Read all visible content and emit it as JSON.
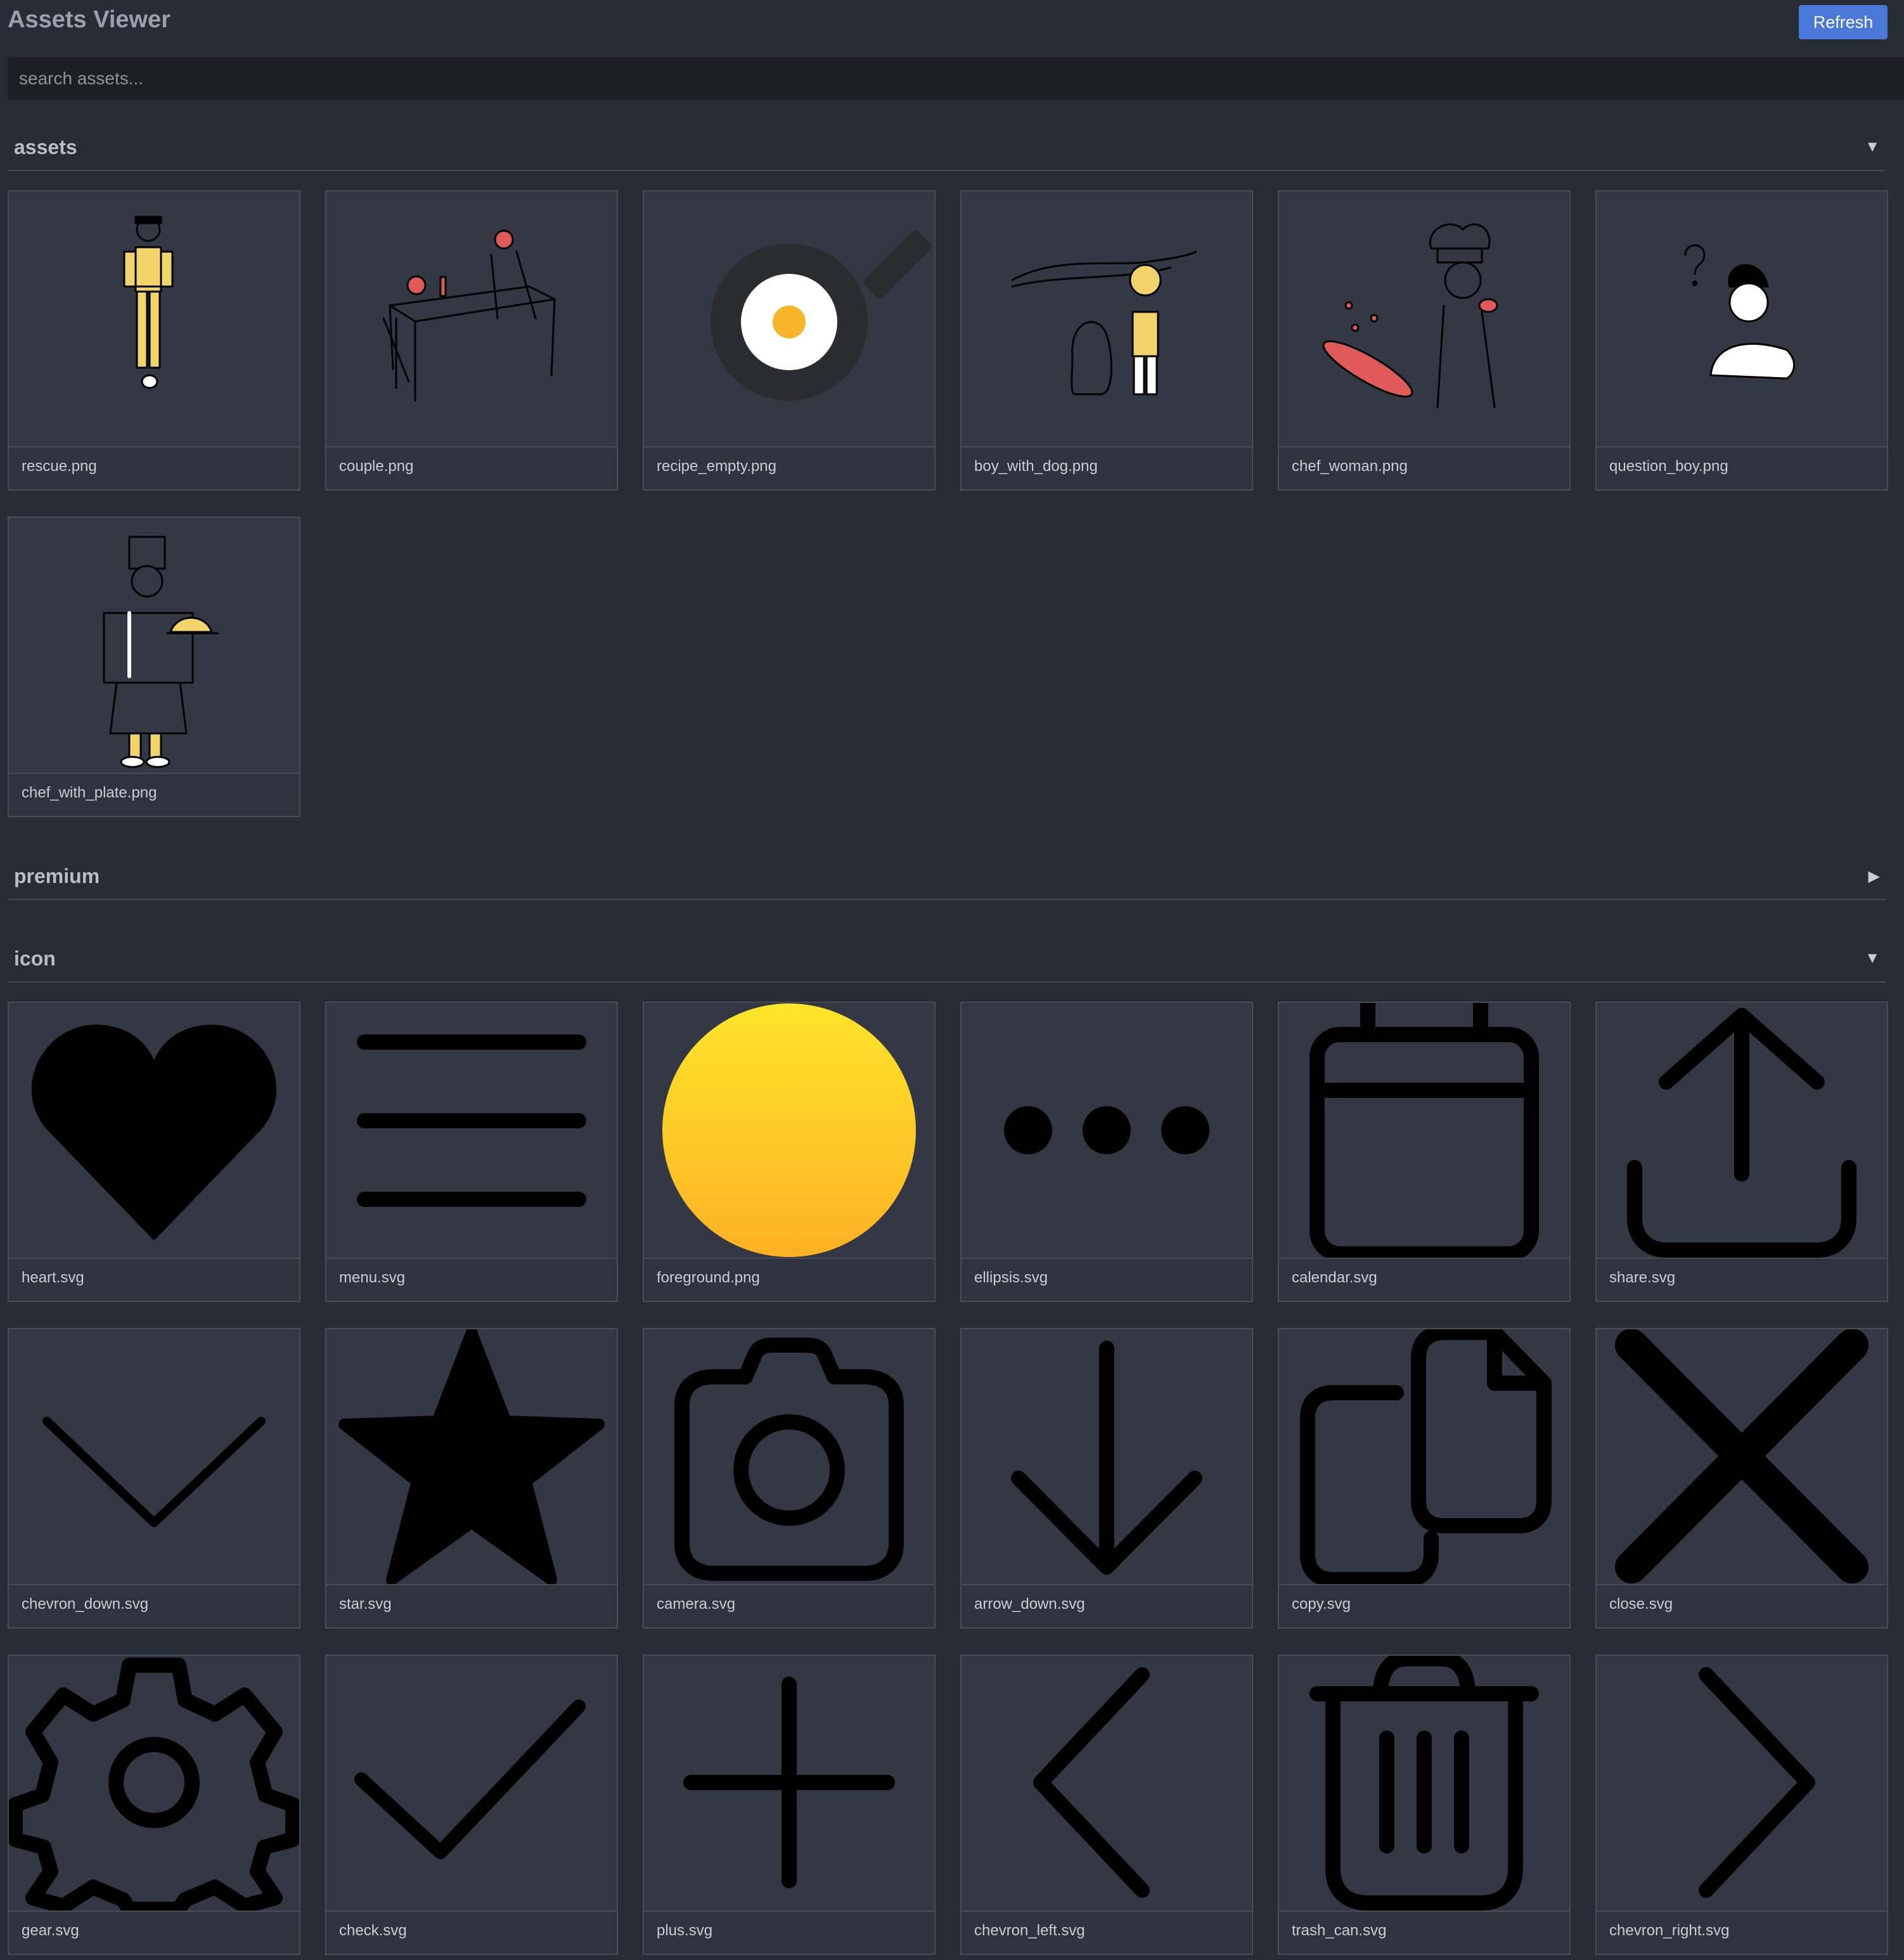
{
  "header": {
    "title": "Assets Viewer",
    "refresh_label": "Refresh"
  },
  "search": {
    "placeholder": "search assets...",
    "value": ""
  },
  "sections": [
    {
      "title": "assets",
      "toggle": "▼",
      "expanded": true,
      "items": [
        {
          "filename": "rescue.png",
          "icon": "rescue-illustration"
        },
        {
          "filename": "couple.png",
          "icon": "couple-illustration"
        },
        {
          "filename": "recipe_empty.png",
          "icon": "frying-pan-egg-illustration"
        },
        {
          "filename": "boy_with_dog.png",
          "icon": "boy-with-dog-illustration"
        },
        {
          "filename": "chef_woman.png",
          "icon": "chef-woman-illustration"
        },
        {
          "filename": "question_boy.png",
          "icon": "question-boy-illustration"
        },
        {
          "filename": "chef_with_plate.png",
          "icon": "chef-with-plate-illustration"
        }
      ]
    },
    {
      "title": "premium",
      "toggle": "▶",
      "expanded": false,
      "items": []
    },
    {
      "title": "icon",
      "toggle": "▼",
      "expanded": true,
      "items": [
        {
          "filename": "heart.svg",
          "icon": "heart-icon"
        },
        {
          "filename": "menu.svg",
          "icon": "menu-icon"
        },
        {
          "filename": "foreground.png",
          "icon": "yellow-circle-icon"
        },
        {
          "filename": "ellipsis.svg",
          "icon": "ellipsis-icon"
        },
        {
          "filename": "calendar.svg",
          "icon": "calendar-icon"
        },
        {
          "filename": "share.svg",
          "icon": "share-icon"
        },
        {
          "filename": "chevron_down.svg",
          "icon": "chevron-down-icon"
        },
        {
          "filename": "star.svg",
          "icon": "star-icon"
        },
        {
          "filename": "camera.svg",
          "icon": "camera-icon"
        },
        {
          "filename": "arrow_down.svg",
          "icon": "arrow-down-icon"
        },
        {
          "filename": "copy.svg",
          "icon": "copy-icon"
        },
        {
          "filename": "close.svg",
          "icon": "close-icon"
        },
        {
          "filename": "gear.svg",
          "icon": "gear-icon"
        },
        {
          "filename": "check.svg",
          "icon": "check-icon"
        },
        {
          "filename": "plus.svg",
          "icon": "plus-icon"
        },
        {
          "filename": "chevron_left.svg",
          "icon": "chevron-left-icon"
        },
        {
          "filename": "trash_can.svg",
          "icon": "trash-can-icon"
        },
        {
          "filename": "chevron_right.svg",
          "icon": "chevron-right-icon"
        }
      ]
    }
  ],
  "colors": {
    "background": "#282c34",
    "card": "#2f333d",
    "accent": "#4a78d8",
    "illustration_yellow": "#f2d46b",
    "illustration_red": "#e05a5a",
    "circle_yellow_top": "#ffe52a",
    "circle_yellow_bottom": "#fdb124"
  }
}
